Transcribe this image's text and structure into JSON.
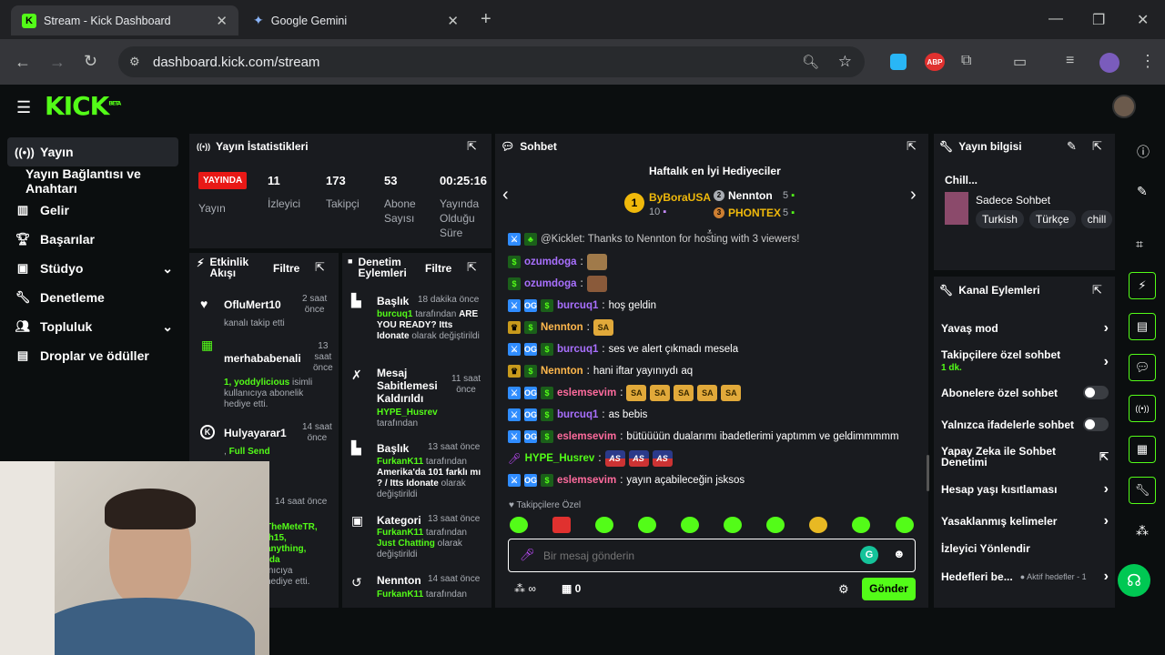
{
  "browser": {
    "tabs": [
      {
        "title": "Stream - Kick Dashboard",
        "active": true
      },
      {
        "title": "Google Gemini",
        "active": false
      }
    ],
    "new_tab": "+",
    "url": "dashboard.kick.com/stream",
    "ext_abp": "ABP"
  },
  "sidebar": {
    "items": [
      {
        "label": "Yayın",
        "icon": "broadcast-icon",
        "active": true
      },
      {
        "label": "Yayın Bağlantısı ve Anahtarı",
        "icon": "",
        "active": false
      },
      {
        "label": "Gelir",
        "icon": "chart-icon",
        "active": false
      },
      {
        "label": "Başarılar",
        "icon": "trophy-icon",
        "active": false
      },
      {
        "label": "Stüdyo",
        "icon": "studio-icon",
        "active": false,
        "expandable": true
      },
      {
        "label": "Denetleme",
        "icon": "wrench-icon",
        "active": false
      },
      {
        "label": "Topluluk",
        "icon": "people-icon",
        "active": false,
        "expandable": true
      },
      {
        "label": "Droplar ve ödüller",
        "icon": "gift-icon",
        "active": false
      }
    ]
  },
  "stats": {
    "title": "Yayın İstatistikleri",
    "live": "YAYINDA",
    "live_label": "Yayın",
    "viewers": "11",
    "viewers_label": "İzleyici",
    "followers": "173",
    "followers_label": "Takipçi",
    "subs": "53",
    "subs_label1": "Abone",
    "subs_label2": "Sayısı",
    "duration": "00:25:16",
    "duration_label1": "Yayında",
    "duration_label2": "Olduğu",
    "duration_label3": "Süre"
  },
  "activity": {
    "title1": "Etkinlik",
    "title2": "Akışı",
    "filter": "Filtre",
    "items": [
      {
        "name": "OfluMert10",
        "time1": "2 saat",
        "time2": "önce",
        "text": "kanalı takip etti"
      },
      {
        "name": "merhababenali",
        "time1": "13",
        "time2": "saat",
        "time3": "önce",
        "g": "1, yoddylicious",
        "text": "isimli kullanıcıya abonelik hediye etti."
      },
      {
        "name": "Hulyayarar1",
        "time1": "14 saat",
        "time2": "önce",
        "prefix": ", ",
        "g": "Full Send"
      },
      {
        "time": "14 saat önce",
        "g1": "TheMeteTR,",
        "g2": "ih15,",
        "g3": "anything,",
        "g4": "rda",
        "t1": "ınıcıya",
        "t2": "hediye etti."
      }
    ]
  },
  "moderation": {
    "title1": "Denetim",
    "title2": "Eylemleri",
    "filter": "Filtre",
    "items": [
      {
        "title": "Başlık",
        "time": "18 dakika önce",
        "user": "burcuq1",
        "by": "tarafından",
        "bold": "ARE YOU READY? Itts Idonate",
        "rest": "olarak değiştirildi"
      },
      {
        "title1": "Mesaj",
        "title2": "Sabitlemesi",
        "title3": "Kaldırıldı",
        "time1": "11 saat",
        "time2": "önce",
        "user": "HYPE_Husrev",
        "by": "tarafından"
      },
      {
        "title": "Başlık",
        "time": "13 saat önce",
        "user": "FurkanK11",
        "by": "tarafından",
        "bold": "Amerika'da 101 farklı mı ? / Itts Idonate",
        "rest": "olarak değiştirildi"
      },
      {
        "title": "Kategori",
        "time": "13 saat önce",
        "user": "FurkanK11",
        "by": "tarafından",
        "bold": "Just Chatting",
        "rest": "olarak değiştirildi"
      },
      {
        "title": "Nennton",
        "time": "14 saat önce",
        "user": "FurkanK11",
        "by": "tarafından"
      }
    ]
  },
  "chat": {
    "title": "Sohbet",
    "gifters_title": "Haftalık en İyi Hediyeciler",
    "gifters": [
      {
        "rank": "1",
        "name": "ByBoraUSA",
        "count": "10"
      },
      {
        "rank": "2",
        "name": "Nennton",
        "count": "5"
      },
      {
        "rank": "3",
        "name": "PHONTEX",
        "count": "5"
      }
    ],
    "partial_line": "@Kicklet: Thanks to Nennton for hosting with 3 viewers!",
    "messages": [
      {
        "user": "ozumdoga",
        "color": "#a970ff",
        "text": ""
      },
      {
        "user": "ozumdoga",
        "color": "#a970ff",
        "text": ""
      },
      {
        "user": "burcuq1",
        "color": "#a970ff",
        "text": "hoş geldin"
      },
      {
        "user": "Nennton",
        "color": "#ffb84d",
        "text": ""
      },
      {
        "user": "burcuq1",
        "color": "#a970ff",
        "text": "ses ve alert çıkmadı mesela"
      },
      {
        "user": "Nennton",
        "color": "#ffb84d",
        "text": "hani iftar yayınıydı aq"
      },
      {
        "user": "eslemsevim",
        "color": "#ff6b9d",
        "text": ""
      },
      {
        "user": "burcuq1",
        "color": "#a970ff",
        "text": "as bebis"
      },
      {
        "user": "eslemsevim",
        "color": "#ff6b9d",
        "text": "bütüüüün dualarımı ibadetlerimi yaptımm ve geldimmmmm"
      },
      {
        "user": "HYPE_Husrev",
        "color": "#53fc18",
        "text": ""
      },
      {
        "user": "eslemsevim",
        "color": "#ff6b9d",
        "text": "yayın açabileceğin jsksos"
      }
    ],
    "emote_sa": "SA",
    "emote_as": "AS",
    "followers_only": "Takipçilere Özel",
    "input_placeholder": "Bir mesaj gönderin",
    "infinity": "∞",
    "drops_count": "0",
    "send": "Gönder"
  },
  "stream_info": {
    "title": "Yayın bilgisi",
    "stream_title": "Chill...",
    "category": "Sadece Sohbet",
    "tags": [
      "Turkish",
      "Türkçe",
      "chill"
    ]
  },
  "channel_actions": {
    "title": "Kanal Eylemleri",
    "items": [
      {
        "label": "Yavaş mod",
        "type": "chevron"
      },
      {
        "label": "Takipçilere özel sohbet",
        "sub": "1 dk.",
        "type": "chevron"
      },
      {
        "label": "Abonelere özel sohbet",
        "type": "toggle"
      },
      {
        "label": "Yalnızca ifadelerle sohbet",
        "type": "toggle"
      },
      {
        "label": "Yapay Zeka ile Sohbet Denetimi",
        "type": "external"
      },
      {
        "label": "Hesap yaşı kısıtlaması",
        "type": "chevron"
      },
      {
        "label": "Yasaklanmış kelimeler",
        "type": "chevron"
      },
      {
        "label": "İzleyici Yönlendir",
        "type": "none"
      },
      {
        "label": "Hedefleri be...",
        "sub": "Aktif hedefler - 1",
        "type": "chevron"
      }
    ]
  },
  "colors": {
    "accent": "#53fc18",
    "live": "#e91916",
    "panel": "#191b1f"
  }
}
